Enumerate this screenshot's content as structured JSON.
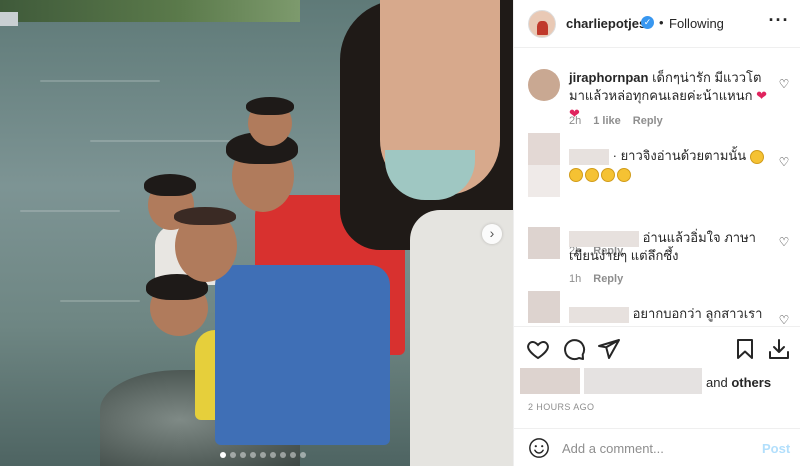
{
  "header": {
    "username": "charliepotjes",
    "separator": "•",
    "follow_status": "Following",
    "more_icon": "more-horizontal-icon"
  },
  "comments": [
    {
      "username": "jiraphornpan",
      "text": "เด็กๆน่ารัก มีแววโตมาแล้วหล่อทุกคนเลยค่ะน้าแหนก",
      "hearts": "❤❤",
      "time": "2h",
      "likes": "1 like",
      "reply": "Reply"
    },
    {
      "username": "",
      "text": "· ยาวจิงอ่านด้วยตามนั้น",
      "time": "2h",
      "reply": "Reply"
    },
    {
      "username": "",
      "text": "อ่านแล้วอิ่มใจ ภาษาเขียนง่ายๆ แต่ลึกซึ้ง",
      "time": "1h",
      "reply": "Reply"
    },
    {
      "username": "",
      "text": "อยากบอกว่า ลูกสาวเรา เปิด",
      "time": "",
      "reply": ""
    }
  ],
  "likes": {
    "suffix_and": "and",
    "suffix_others": "others"
  },
  "timestamp": "2 HOURS AGO",
  "add_comment": {
    "placeholder": "Add a comment...",
    "post_label": "Post"
  },
  "colors": {
    "accent": "#3897f0",
    "post_disabled": "#b2dffc",
    "heart_red": "#e0245e"
  }
}
